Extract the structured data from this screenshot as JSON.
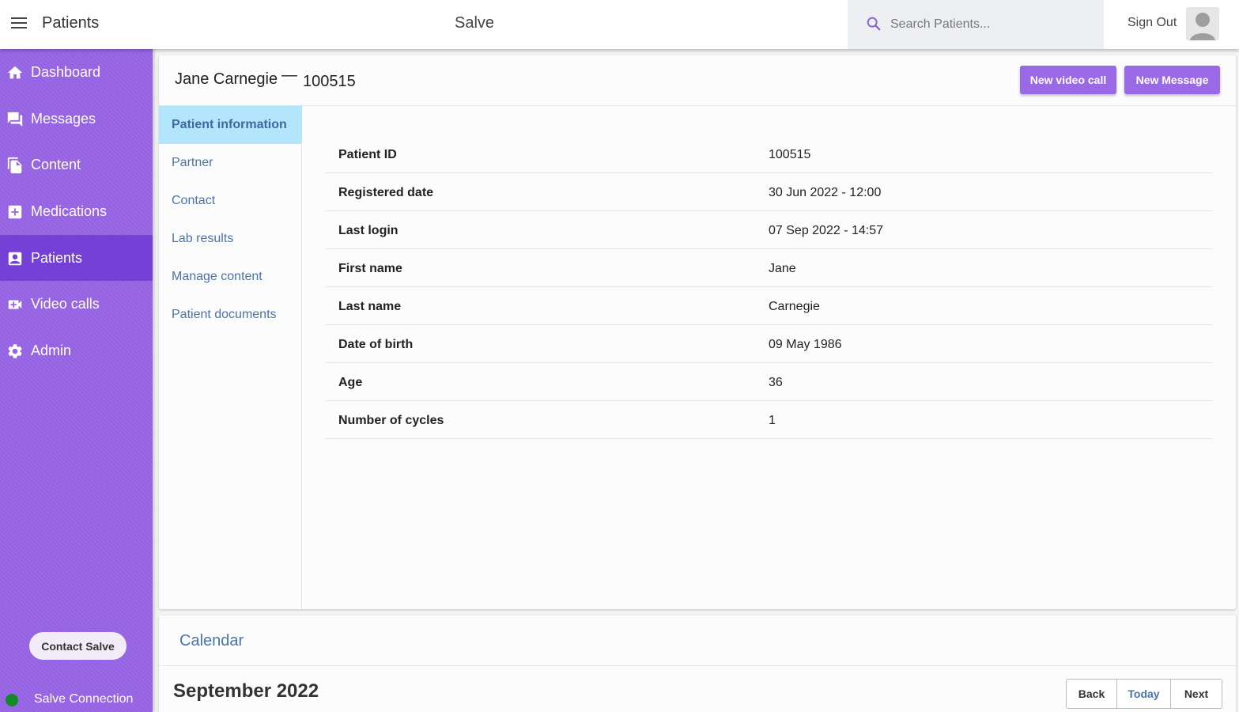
{
  "topbar": {
    "title": "Patients",
    "app_name": "Salve",
    "search_placeholder": "Search Patients...",
    "sign_out": "Sign Out"
  },
  "sidebar": {
    "items": [
      {
        "label": "Dashboard",
        "icon": "home-icon"
      },
      {
        "label": "Messages",
        "icon": "chat-icon"
      },
      {
        "label": "Content",
        "icon": "documents-icon"
      },
      {
        "label": "Medications",
        "icon": "medical-plus-icon"
      },
      {
        "label": "Patients",
        "icon": "contact-card-icon",
        "active": true
      },
      {
        "label": "Video calls",
        "icon": "video-camera-icon"
      },
      {
        "label": "Admin",
        "icon": "gear-icon"
      }
    ],
    "contact_button": "Contact Salve",
    "connection_label": "Salve Connection",
    "connection_color": "#138a25"
  },
  "patient": {
    "name": "Jane Carnegie",
    "dash": "—",
    "id": "100515",
    "new_video_call": "New video call",
    "new_message": "New Message"
  },
  "tabs": [
    {
      "label": "Patient information",
      "active": true
    },
    {
      "label": "Partner"
    },
    {
      "label": "Contact"
    },
    {
      "label": "Lab results"
    },
    {
      "label": "Manage content"
    },
    {
      "label": "Patient documents"
    }
  ],
  "info_rows": [
    {
      "key": "Patient ID",
      "value": "100515"
    },
    {
      "key": "Registered date",
      "value": "30 Jun 2022 - 12:00"
    },
    {
      "key": "Last login",
      "value": "07 Sep 2022 - 14:57"
    },
    {
      "key": "First name",
      "value": "Jane"
    },
    {
      "key": "Last name",
      "value": "Carnegie"
    },
    {
      "key": "Date of birth",
      "value": "09 May 1986"
    },
    {
      "key": "Age",
      "value": "36"
    },
    {
      "key": "Number of cycles",
      "value": "1"
    }
  ],
  "calendar": {
    "title": "Calendar",
    "month": "September 2022",
    "back": "Back",
    "today": "Today",
    "next": "Next"
  },
  "colors": {
    "accent": "#9a6ae6",
    "active_nav": "#7440d6",
    "active_tab": "#b3e5fc",
    "link": "#4a74a8"
  }
}
